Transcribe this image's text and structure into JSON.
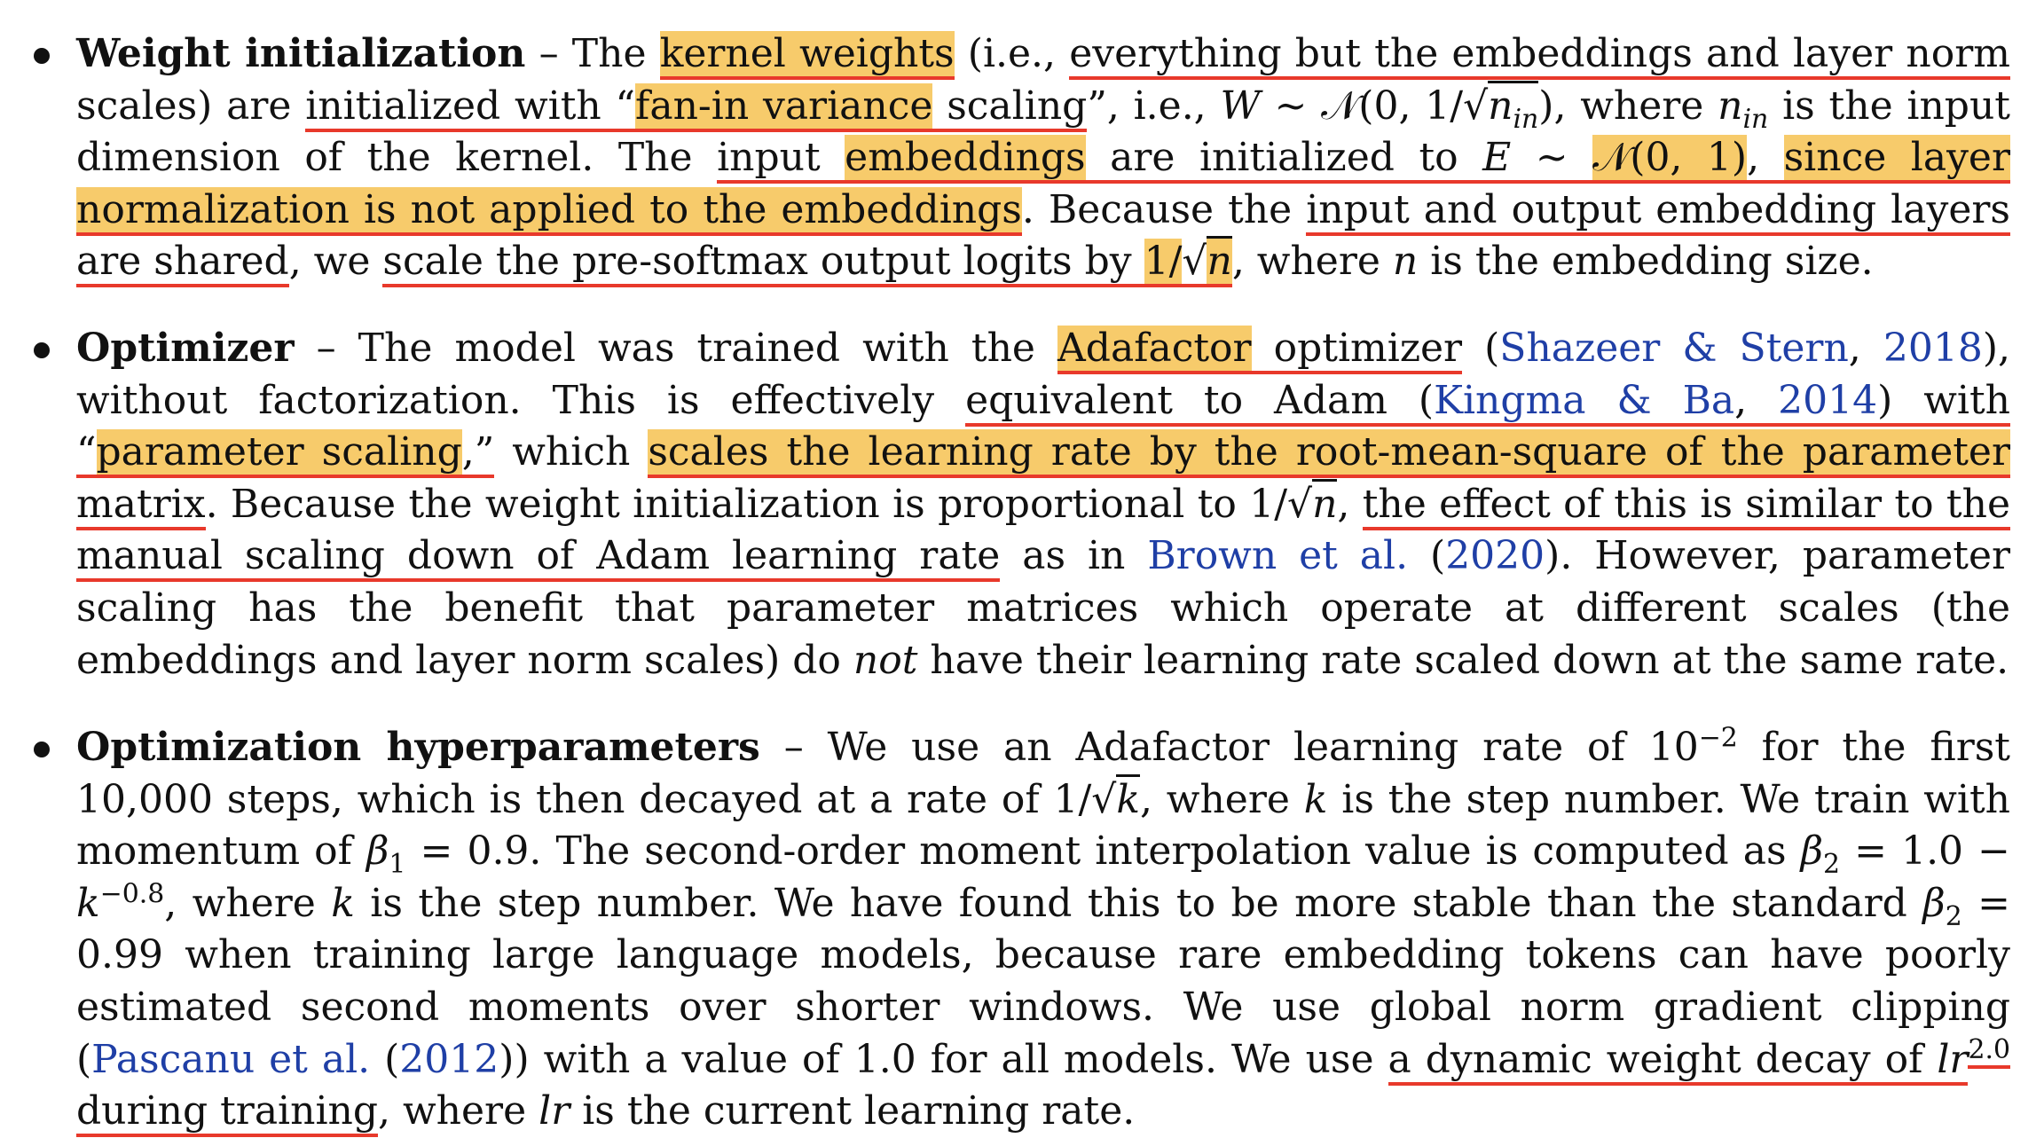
{
  "colors": {
    "highlight": "#f7cb6b",
    "underline": "#e8392b",
    "citation": "#1f3fa6"
  },
  "bullets": [
    {
      "title": "Weight initialization",
      "dash": "–",
      "t1": "The ",
      "kernel_weights": "kernel weights",
      "t2": " (i.e., ",
      "everything": "everything but the embeddings and layer norm",
      "t3": " scales) are ",
      "initialized": "initialized with “",
      "fanin": "fan-in variance",
      "scaling_q": " scaling",
      "t4": "”, i.e., ",
      "W": "W",
      "sim1": " ∼ 𝒩(0, 1/",
      "n_in": "n",
      "in_sub": "in",
      "t5": "), where ",
      "n_in2": "n",
      "in_sub2": "in",
      "t6": " is the input dimension of the kernel. The ",
      "input": "input ",
      "embeddings": "embeddings",
      "init_to": " are initialized to ",
      "E": "E",
      "sim2": " ∼ ",
      "normal": "𝒩(0, 1)",
      "comma": ", ",
      "since": "since layer normalization is not applied to the embeddings",
      "t7": ". Because the ",
      "shared": "input and output embedding layers are shared",
      "t8": ", we ",
      "scale": "scale the pre-softmax output logits by ",
      "oneover": "1/",
      "sqrt_n": "n",
      "t9": ", where ",
      "n": "n",
      "t10": " is the embedding size."
    },
    {
      "title": "Optimizer",
      "dash": "–",
      "t1": "The model was trained with the ",
      "adafactor": "Adafactor",
      "optimizer": " optimizer",
      "t2": " (",
      "cite1a": "Shazeer & Stern",
      "t3": ", ",
      "cite1b": "2018",
      "t4": "), without factorization. This is effectively ",
      "equiv": "equivalent to Adam (",
      "cite2a": "Kingma & Ba",
      "c2": ", ",
      "cite2b": "2014",
      "with": ") with “",
      "param_scaling": "parameter scaling",
      "q_end": ",”",
      "t5": " which ",
      "scales": "scales the learning rate by the root-mean-square of the parameter",
      "matrix": " matrix",
      "t6": ". Because the weight initialization is proportional to 1/",
      "sqrt_n": "n",
      "t7": ", ",
      "effect": "the effect of this is similar to the manual scaling down of Adam learning rate",
      "t8": " as in ",
      "cite3a": "Brown et al.",
      "t9": " (",
      "cite3b": "2020",
      "t10": "). However, parameter scaling has the benefit that parameter matrices which operate at different scales (the embeddings and layer norm scales) do ",
      "not": "not",
      "t11": " have their learning rate scaled down at the same rate."
    },
    {
      "title": "Optimization hyperparameters",
      "dash": "–",
      "t1": "We use an Adafactor learning rate of 10",
      "exp1": "−2",
      "t2": " for the first 10,000 steps, which is then decayed at a rate of 1/",
      "sqrt_k": "k",
      "t3": ", where ",
      "k1": "k",
      "t4": " is the step number. We train with momentum of ",
      "beta1": "β",
      "one": "1",
      "t5": " = 0.9. The second-order moment interpolation value is computed as ",
      "beta2": "β",
      "two": "2",
      "t6": " = 1.0 − ",
      "k2": "k",
      "exp2": "−0.8",
      "t7": ", where ",
      "k3": "k",
      "t8": " is the step number. We have found this to be more stable than the standard ",
      "beta3": "β",
      "two2": "2",
      "t9": " = 0.99 when training large language models, because rare embedding tokens can have poorly estimated second moments over shorter windows. We use global norm gradient clipping (",
      "cite4a": "Pascanu et al.",
      "t10": " (",
      "cite4b": "2012",
      "t11": ")) with a value of 1.0 for all models. We use ",
      "decay": "a dynamic weight decay of ",
      "lr": "lr",
      "exp3": "2.0",
      "during": " during training",
      "t12": ", where ",
      "lr2": "lr",
      "t13": " is the current learning rate."
    }
  ]
}
